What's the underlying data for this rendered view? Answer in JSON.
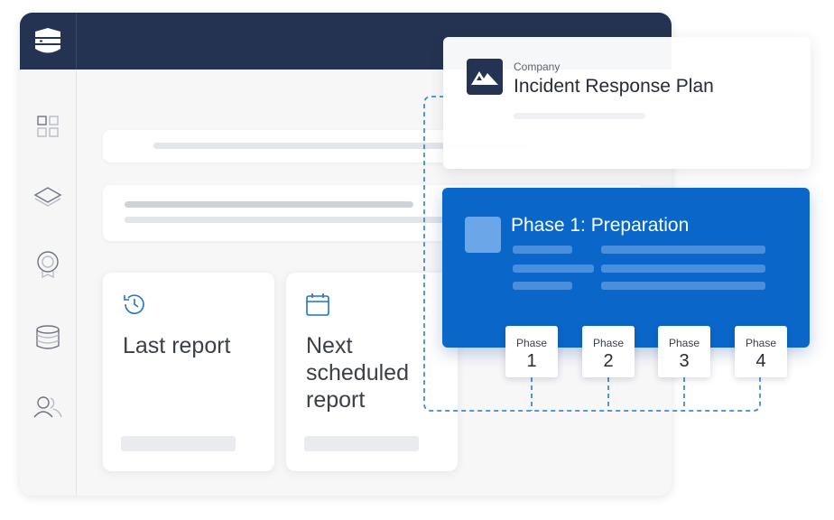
{
  "colors": {
    "topbar": "#253352",
    "accent_blue": "#0a67c9",
    "connector": "#3d8ad8",
    "icon_blue": "#1e73c8",
    "sidebar_icon": "#6f7482"
  },
  "sidebar": {
    "logo": "shield-logo-icon",
    "items": [
      {
        "icon": "grid-icon"
      },
      {
        "icon": "layers-icon"
      },
      {
        "icon": "award-icon"
      },
      {
        "icon": "database-icon"
      },
      {
        "icon": "users-icon"
      }
    ]
  },
  "reports": [
    {
      "icon": "history-icon",
      "title": "Last report"
    },
    {
      "icon": "calendar-icon",
      "title": "Next\nscheduled\nreport"
    }
  ],
  "company_card": {
    "logo": "mountain-logo-icon",
    "label": "Company",
    "title": "Incident Response Plan"
  },
  "phase_card": {
    "title": "Phase 1: Preparation"
  },
  "phases": [
    {
      "label": "Phase",
      "number": "1"
    },
    {
      "label": "Phase",
      "number": "2"
    },
    {
      "label": "Phase",
      "number": "3"
    },
    {
      "label": "Phase",
      "number": "4"
    }
  ]
}
